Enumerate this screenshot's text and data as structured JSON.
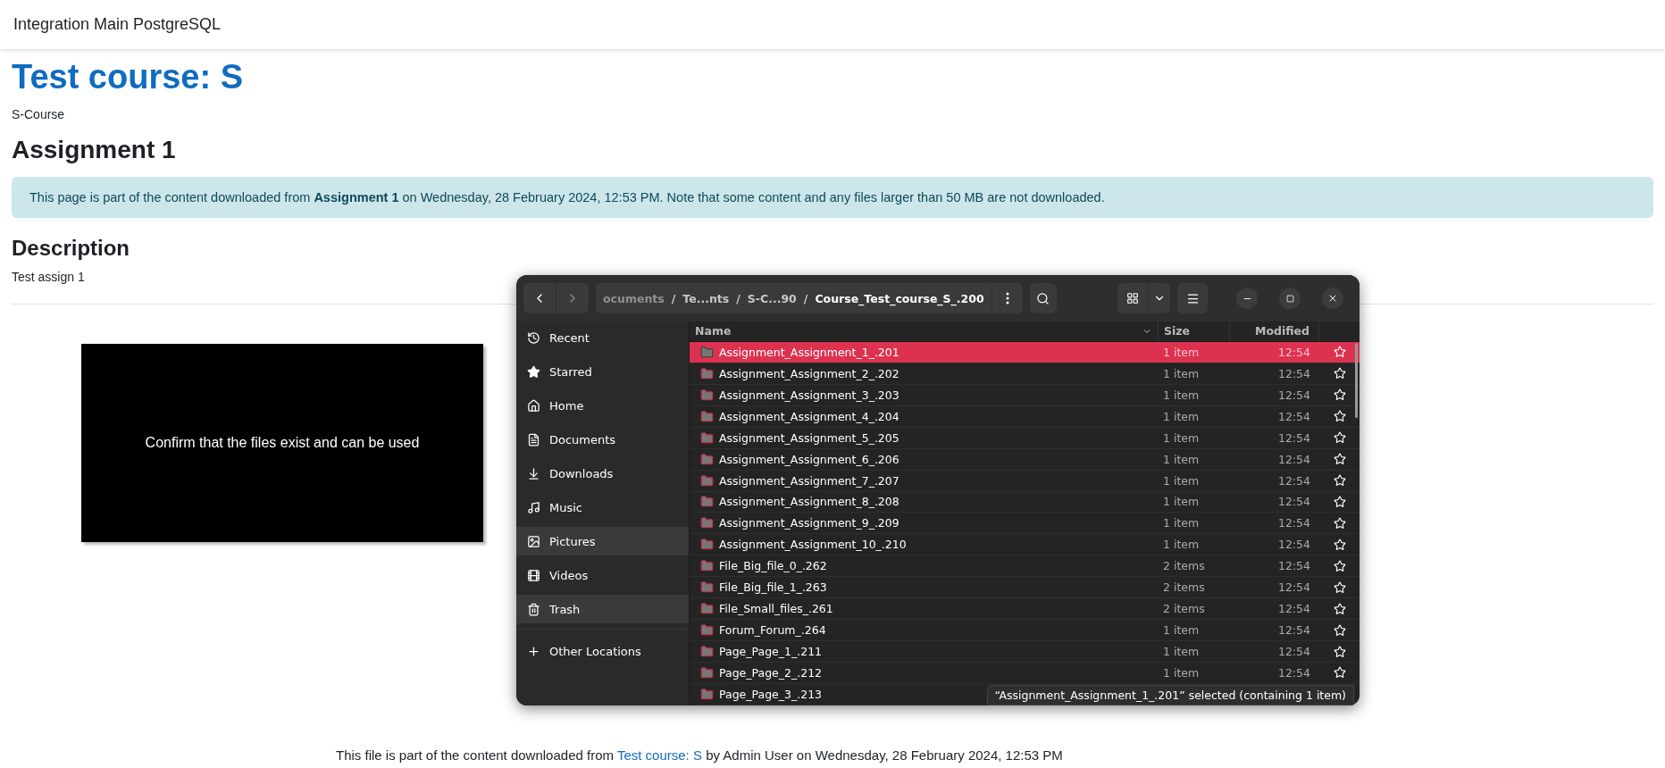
{
  "site_header": {
    "title": "Integration Main PostgreSQL"
  },
  "page": {
    "course_title": "Test course: S",
    "course_subtitle": "S-Course",
    "heading": "Assignment 1",
    "notice": "This page is part of the content downloaded from **Assignment 1** on Wednesday, 28 February 2024, 12:53 PM. Note that some content and any files larger than 50 MB are not downloaded.",
    "description_heading": "Description",
    "description": "Test assign 1",
    "video_caption": "Confirm that the files exist and can be used",
    "footer_text_before": "This file is part of the content downloaded from",
    "footer_link": "Test course: S",
    "footer_text_after": "by Admin User on Wednesday, 28 February 2024, 12:53 PM"
  },
  "file_manager": {
    "breadcrumbs": [
      {
        "label": "ocuments",
        "kind": "crumb"
      },
      {
        "label": "/",
        "kind": "separator"
      },
      {
        "label": "Te...nts",
        "kind": "crumb"
      },
      {
        "label": "/",
        "kind": "separator"
      },
      {
        "label": "S-C...90",
        "kind": "crumb"
      },
      {
        "label": "/",
        "kind": "separator"
      },
      {
        "label": "Course_Test_course_S_.200",
        "kind": "current"
      }
    ],
    "sidebar": [
      {
        "label": "Recent",
        "highlighted": false
      },
      {
        "label": "Starred",
        "highlighted": false
      },
      {
        "label": "Home",
        "highlighted": false
      },
      {
        "label": "Documents",
        "highlighted": false
      },
      {
        "label": "Downloads",
        "highlighted": false
      },
      {
        "label": "Music",
        "highlighted": false
      },
      {
        "label": "Pictures",
        "highlighted": true
      },
      {
        "label": "Videos",
        "highlighted": false
      },
      {
        "label": "Trash",
        "highlighted": true
      }
    ],
    "other_locations": "Other Locations",
    "columns": [
      "Name",
      "Size",
      "Modified"
    ],
    "rows": [
      {
        "name": "Assignment_Assignment_1_.201",
        "size": "1 item",
        "modified": "12:54",
        "selected": true
      },
      {
        "name": "Assignment_Assignment_2_.202",
        "size": "1 item",
        "modified": "12:54",
        "selected": false
      },
      {
        "name": "Assignment_Assignment_3_.203",
        "size": "1 item",
        "modified": "12:54",
        "selected": false
      },
      {
        "name": "Assignment_Assignment_4_.204",
        "size": "1 item",
        "modified": "12:54",
        "selected": false
      },
      {
        "name": "Assignment_Assignment_5_.205",
        "size": "1 item",
        "modified": "12:54",
        "selected": false
      },
      {
        "name": "Assignment_Assignment_6_.206",
        "size": "1 item",
        "modified": "12:54",
        "selected": false
      },
      {
        "name": "Assignment_Assignment_7_.207",
        "size": "1 item",
        "modified": "12:54",
        "selected": false
      },
      {
        "name": "Assignment_Assignment_8_.208",
        "size": "1 item",
        "modified": "12:54",
        "selected": false
      },
      {
        "name": "Assignment_Assignment_9_.209",
        "size": "1 item",
        "modified": "12:54",
        "selected": false
      },
      {
        "name": "Assignment_Assignment_10_.210",
        "size": "1 item",
        "modified": "12:54",
        "selected": false
      },
      {
        "name": "File_Big_file_0_.262",
        "size": "2 items",
        "modified": "12:54",
        "selected": false
      },
      {
        "name": "File_Big_file_1_.263",
        "size": "2 items",
        "modified": "12:54",
        "selected": false
      },
      {
        "name": "File_Small_files_.261",
        "size": "2 items",
        "modified": "12:54",
        "selected": false
      },
      {
        "name": "Forum_Forum_.264",
        "size": "1 item",
        "modified": "12:54",
        "selected": false
      },
      {
        "name": "Page_Page_1_.211",
        "size": "1 item",
        "modified": "12:54",
        "selected": false
      },
      {
        "name": "Page_Page_2_.212",
        "size": "1 item",
        "modified": "12:54",
        "selected": false
      },
      {
        "name": "Page_Page_3_.213",
        "selected": false
      }
    ],
    "status": "“Assignment_Assignment_1_.201” selected  (containing 1 item)"
  }
}
